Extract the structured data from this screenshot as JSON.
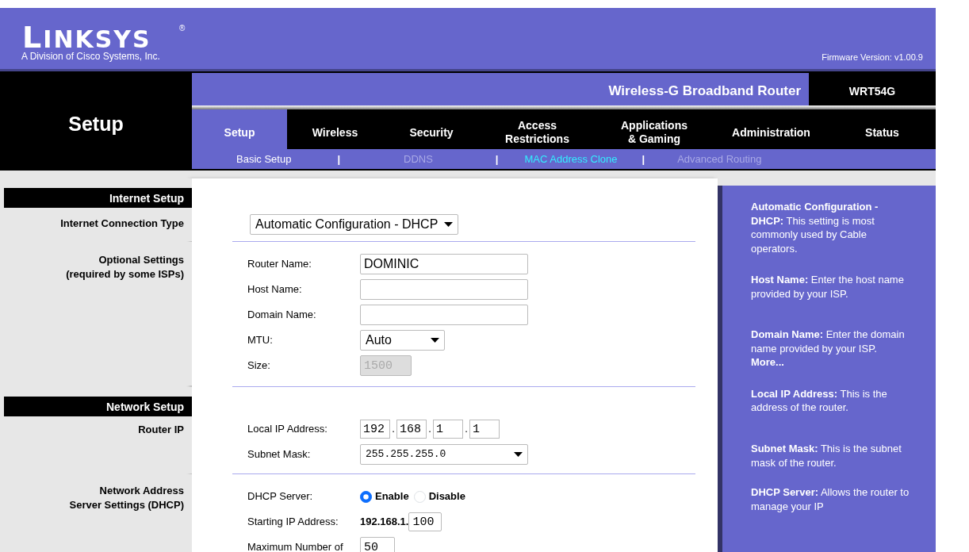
{
  "header": {
    "logo": "LINKSYS",
    "logo_mark": "®",
    "tagline": "A Division of Cisco Systems, Inc.",
    "firmware": "Firmware Version: v1.00.9"
  },
  "page_title": "Setup",
  "product_name": "Wireless-G Broadband Router",
  "model": "WRT54G",
  "tabs": [
    {
      "label": "Setup",
      "selected": true
    },
    {
      "label": "Wireless",
      "selected": false
    },
    {
      "label": "Security",
      "selected": false
    },
    {
      "label": "Access\nRestrictions",
      "selected": false
    },
    {
      "label": "Applications\n& Gaming",
      "selected": false
    },
    {
      "label": "Administration",
      "selected": false
    },
    {
      "label": "Status",
      "selected": false
    }
  ],
  "subtabs": [
    {
      "kind": "link",
      "label": "Basic Setup",
      "selected": true,
      "hovered": false
    },
    {
      "kind": "separator",
      "label": "|"
    },
    {
      "kind": "link",
      "label": "DDNS",
      "selected": false,
      "hovered": false
    },
    {
      "kind": "separator",
      "label": "|"
    },
    {
      "kind": "link",
      "label": "MAC Address Clone",
      "selected": false,
      "hovered": true
    },
    {
      "kind": "separator",
      "label": "|"
    },
    {
      "kind": "link",
      "label": "Advanced Routing",
      "selected": false,
      "hovered": false
    }
  ],
  "sections": [
    {
      "heading": "Internet Setup",
      "groups": [
        {
          "label": "Internet Connection Type",
          "fields": [
            {
              "kind": "wide-select",
              "value": "Automatic Configuration - DHCP"
            }
          ]
        },
        {
          "label": "Optional Settings\n(required by some ISPs)",
          "fields": [
            {
              "kind": "text",
              "label": "Router Name:",
              "value": "DOMINIC"
            },
            {
              "kind": "text",
              "label": "Host Name:"
            },
            {
              "kind": "text",
              "label": "Domain Name:"
            },
            {
              "kind": "select",
              "label": "MTU:",
              "value": "Auto"
            },
            {
              "kind": "small-text",
              "label": "Size:",
              "value": "1500",
              "disabled": true
            }
          ]
        }
      ]
    },
    {
      "heading": "Network Setup",
      "groups": [
        {
          "label": "Router IP",
          "fields": [
            {
              "kind": "ip",
              "label": "Local IP Address:",
              "octets": [
                "192",
                "168",
                "1",
                "1"
              ],
              "dot": "."
            },
            {
              "kind": "mask",
              "label": "Subnet Mask:",
              "value": "255.255.255.0"
            }
          ]
        },
        {
          "label": "Network Address\nServer Settings (DHCP)",
          "fields": [
            {
              "kind": "radio",
              "label": "DHCP Server:",
              "options": [
                {
                  "label": "Enable",
                  "selected": true
                },
                {
                  "label": "Disable",
                  "selected": false
                }
              ]
            },
            {
              "kind": "prefixed",
              "label": "Starting IP Address:",
              "prefix": "192.168.1.",
              "value": "100"
            },
            {
              "kind": "small-text",
              "label": "Maximum Number of",
              "value": "50",
              "disabled": false
            }
          ]
        }
      ]
    }
  ],
  "help": [
    {
      "kind": "text",
      "text": "**Automatic Configuration - DHCP:** This setting is most commonly used by Cable operators."
    },
    {
      "kind": "text",
      "text": "**Host Name:** Enter the host name provided by your ISP."
    },
    {
      "kind": "text",
      "text": "**Domain Name:** Enter the domain name provided by your ISP."
    },
    {
      "kind": "link",
      "text": "More..."
    },
    {
      "kind": "text",
      "text": "**Local IP Address:** This is the address of the router."
    },
    {
      "kind": "text",
      "text": "**Subnet Mask:** This is the subnet mask of the router."
    },
    {
      "kind": "text",
      "text": "**DHCP Server:** Allows the router to manage your IP"
    }
  ]
}
